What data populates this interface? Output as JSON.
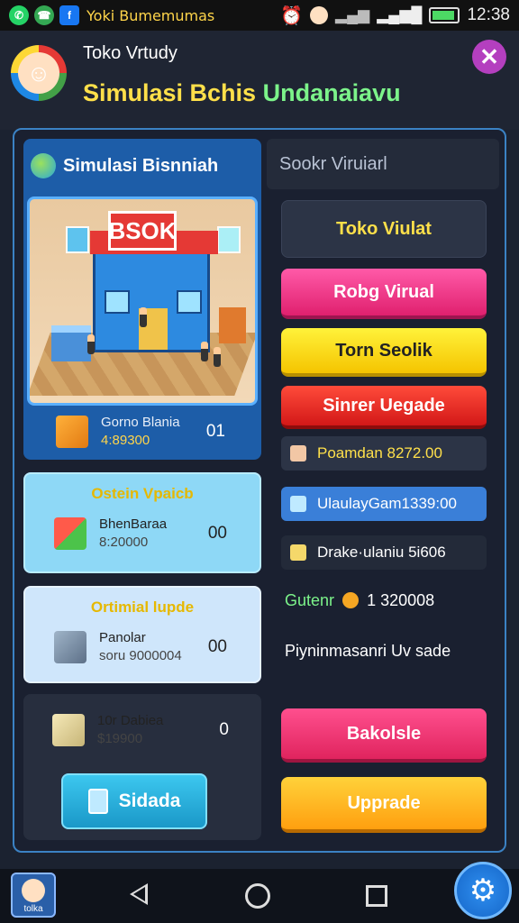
{
  "status_bar": {
    "app_label": "Yoki Bumemumas",
    "time": "12:38",
    "icons": [
      "whatsapp-icon",
      "phone-icon",
      "facebook-icon",
      "alarm-icon",
      "profile-icon",
      "signal-icon",
      "wifi-signal-icon",
      "battery-icon"
    ]
  },
  "header": {
    "subtitle": "Toko Vrtudy",
    "title_part1": "Simulasi Bchis",
    "title_part2": "Undanaiavu",
    "close_symbol": "✕"
  },
  "left_panel": {
    "title": "Simulasi Bisnniah",
    "scene_sign": "BSOK",
    "inventory_item": {
      "name": "Gorno Blania",
      "price": "4:89300",
      "count": "01"
    },
    "card1": {
      "title": "Ostein Vpaicb",
      "name": "BhenBaraa",
      "price": "8:20000",
      "count": "00"
    },
    "card2": {
      "title": "Ortimial lupde",
      "name": "Panolar",
      "price": "soru 9000004",
      "count": "00"
    },
    "card3": {
      "name": "10r Dabiea",
      "price": "$19900",
      "count": "0",
      "button": "Sidada"
    }
  },
  "right_panel": {
    "header": "Sookr Viruiarl",
    "buttons": {
      "toko": "Toko Viulat",
      "roby": "Robg Virual",
      "torn": "Torn Seolik",
      "sinner": "Sinrer Uegade",
      "bakolsle": "Bakolsle",
      "upgrade": "Upprade"
    },
    "rows": {
      "poamdan": "Poamdan  8272.00",
      "ulauluy": "UlaulayGam1339:00",
      "drakke": "Drake·ulaniu 5i606"
    },
    "gutenr_label": "Gutenr",
    "gutenr_value": "1 320008",
    "pinmian": "Piyninmasanri Uv sade"
  },
  "nav": {
    "app_label": "tolka"
  },
  "colors": {
    "background": "#1b2230",
    "accent_blue": "#3b82c4",
    "title_yellow": "#ffe04a",
    "title_green": "#7cf38a",
    "close_purple": "#b43fbf"
  }
}
